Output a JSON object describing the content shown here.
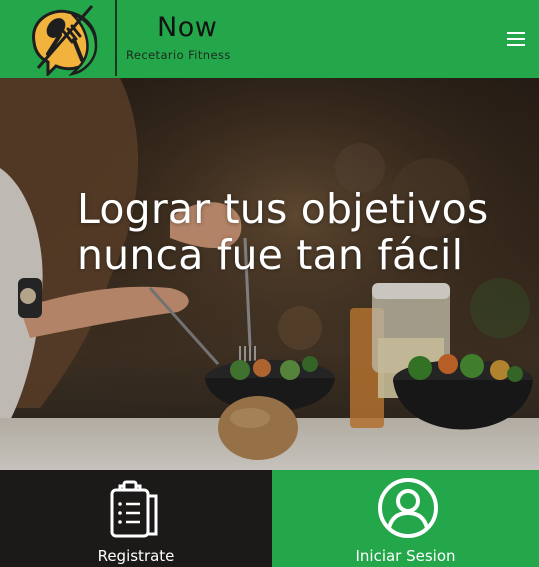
{
  "brand": {
    "name": "Now",
    "tagline": "Recetario Fitness",
    "logo_icon": "fork-spoon-speech-bubble-icon",
    "color": "#23a74a"
  },
  "nav": {
    "menu_icon": "hamburger-menu-icon"
  },
  "hero": {
    "headline": "Lograr tus objetivos nunca fue tan fácil"
  },
  "actions": {
    "register_label": "Registrate",
    "register_icon": "clipboard-list-icon",
    "login_label": "Iniciar Sesion",
    "login_icon": "user-circle-icon"
  }
}
